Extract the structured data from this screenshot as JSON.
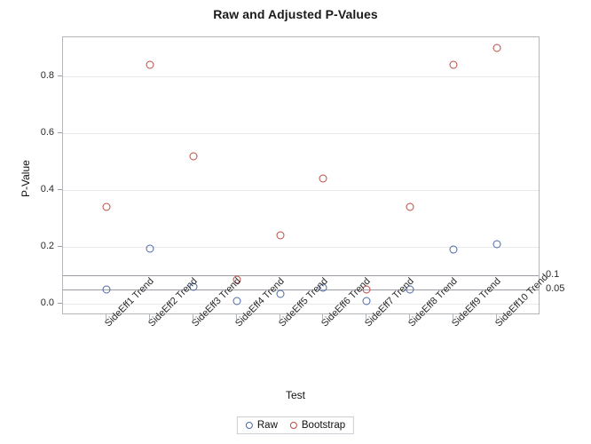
{
  "chart_data": {
    "type": "scatter",
    "title": "Raw and Adjusted P-Values",
    "xlabel": "Test",
    "ylabel": "P-Value",
    "categories": [
      "SideEff1 Trend",
      "SideEff2 Trend",
      "SideEff3 Trend",
      "SideEff4 Trend",
      "SideEff5 Trend",
      "SideEff6 Trend",
      "SideEff7 Trend",
      "SideEff8 Trend",
      "SideEff9 Trend",
      "SideEff10 Trend"
    ],
    "series": [
      {
        "name": "Raw",
        "color": "#4a69a8",
        "marker": "open-circle",
        "values": [
          0.05,
          0.195,
          0.06,
          0.01,
          0.035,
          0.055,
          0.01,
          0.05,
          0.19,
          0.21
        ]
      },
      {
        "name": "Bootstrap",
        "color": "#bf4a42",
        "marker": "open-circle",
        "values": [
          0.34,
          0.84,
          0.52,
          0.085,
          0.24,
          0.44,
          0.05,
          0.34,
          0.84,
          0.9
        ]
      }
    ],
    "ylim": [
      -0.03,
      0.955
    ],
    "yticks": [
      0.0,
      0.2,
      0.4,
      0.6,
      0.8
    ],
    "ytick_labels": [
      "0.0",
      "0.2",
      "0.4",
      "0.6",
      "0.8"
    ],
    "grid": true,
    "reference_lines": [
      {
        "value": 0.1,
        "label": "0.1"
      },
      {
        "value": 0.05,
        "label": "0.05"
      }
    ],
    "legend_position": "bottom",
    "legend_entries": [
      "Raw",
      "Bootstrap"
    ]
  }
}
